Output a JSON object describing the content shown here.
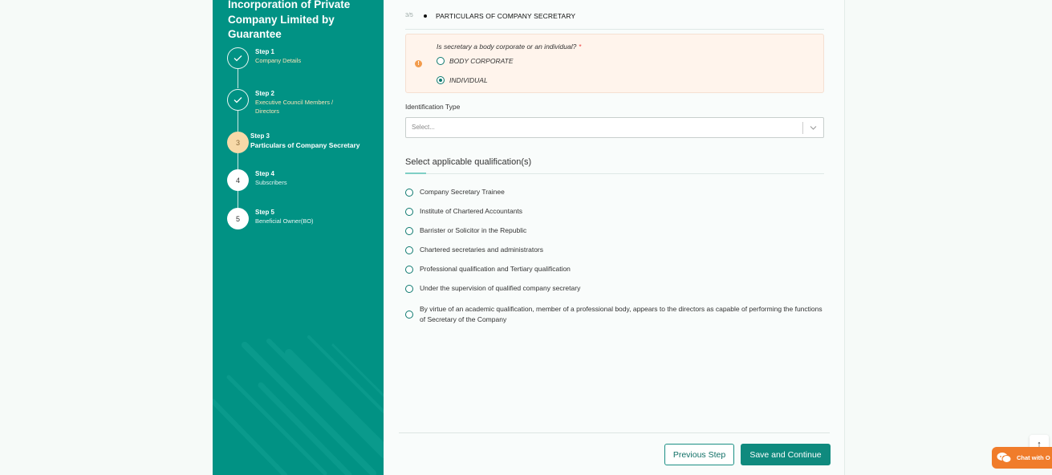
{
  "sidebar": {
    "title": "Incorporation of Private Company Limited by Guarantee",
    "steps": [
      {
        "num": "Step 1",
        "name": "Company Details",
        "status": "done"
      },
      {
        "num": "Step 2",
        "name": "Executive Council Members / Directors",
        "status": "done"
      },
      {
        "num": "Step 3",
        "name": "Particulars of Company Secretary",
        "status": "current",
        "badge": "3"
      },
      {
        "num": "Step 4",
        "name": "Subscribers",
        "status": "todo",
        "badge": "4"
      },
      {
        "num": "Step 5",
        "name": "Beneficial Owner(BO)",
        "status": "todo",
        "badge": "5"
      }
    ]
  },
  "section": {
    "count": "3/5",
    "title": "PARTICULARS OF COMPANY SECRETARY"
  },
  "question": {
    "label": "Is secretary a body corporate or an individual?",
    "required_mark": "*",
    "options": [
      {
        "label": "BODY CORPORATE",
        "selected": false
      },
      {
        "label": "INDIVIDUAL",
        "selected": true
      }
    ]
  },
  "identification": {
    "label": "Identification Type",
    "placeholder": "Select..."
  },
  "qualifications": {
    "title": "Select applicable qualification(s)",
    "items": [
      "Company Secretary Trainee",
      "Institute of Chartered Accountants",
      "Barrister or Solicitor in the Republic",
      "Chartered secretaries and administrators",
      "Professional qualification and Tertiary qualification",
      "Under the supervision of qualified company secretary",
      "By virtue of an academic qualification, member of a professional body, appears to the directors as capable of performing the functions of Secretary of the Company"
    ]
  },
  "footer": {
    "prev_label": "Previous Step",
    "save_label": "Save and Continue"
  },
  "widgets": {
    "scroll_top": "↑",
    "chat_label": "Chat with O"
  },
  "colors": {
    "sidebar": "#019284",
    "primary": "#0f8a7e",
    "warning": "#f29b4c",
    "chat": "#f07c2b"
  }
}
